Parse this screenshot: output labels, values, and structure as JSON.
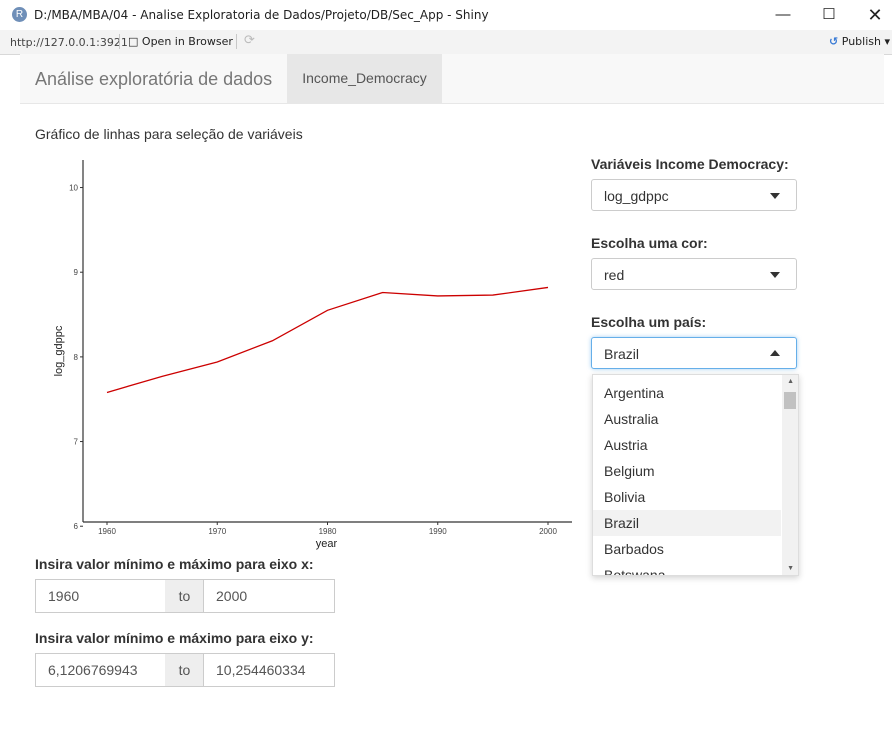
{
  "window": {
    "icon": "R",
    "title": "D:/MBA/MBA/04 - Analise Exploratoria de Dados/Projeto/DB/Sec_App - Shiny",
    "min_icon": "minimize-icon",
    "max_icon": "maximize-icon",
    "close_icon": "close-icon"
  },
  "toolbar": {
    "url": "http://127.0.0.1:3921",
    "open_browser": "Open in Browser",
    "publish": "Publish"
  },
  "navbar": {
    "brand": "Análise exploratória de dados",
    "tab": "Income_Democracy"
  },
  "chart_title": "Gráfico de linhas para seleção de variáveis",
  "chart_data": {
    "type": "line",
    "xlabel": "year",
    "ylabel": "log_gdppc",
    "x": [
      1960,
      1965,
      1970,
      1975,
      1980,
      1985,
      1990,
      1995,
      2000
    ],
    "series": [
      {
        "color": "#cc0000",
        "values": [
          7.58,
          7.77,
          7.94,
          8.19,
          8.55,
          8.76,
          8.72,
          8.73,
          8.82
        ]
      }
    ],
    "xlim": [
      1960,
      2000
    ],
    "ylim": [
      6.1206769943,
      10.254460334
    ],
    "xticks": [
      1960,
      1970,
      1980,
      1990,
      2000
    ],
    "yticks": [
      6,
      7,
      8,
      9,
      10
    ],
    "grid": false,
    "accent": "#cc0000"
  },
  "controls": {
    "var_label": "Variáveis Income Democracy:",
    "var_value": "log_gdppc",
    "color_label": "Escolha uma cor:",
    "color_value": "red",
    "country_label": "Escolha um país:",
    "country_value": "Brazil",
    "country_options": [
      "Argentina",
      "Australia",
      "Austria",
      "Belgium",
      "Bolivia",
      "Brazil",
      "Barbados",
      "Botswana"
    ],
    "country_selected_index": 5
  },
  "xrange": {
    "label": "Insira valor mínimo e máximo para eixo x:",
    "min": "1960",
    "to": "to",
    "max": "2000"
  },
  "yrange": {
    "label": "Insira valor mínimo e máximo para eixo y:",
    "min": "6,1206769943",
    "to": "to",
    "max": "10,254460334"
  }
}
